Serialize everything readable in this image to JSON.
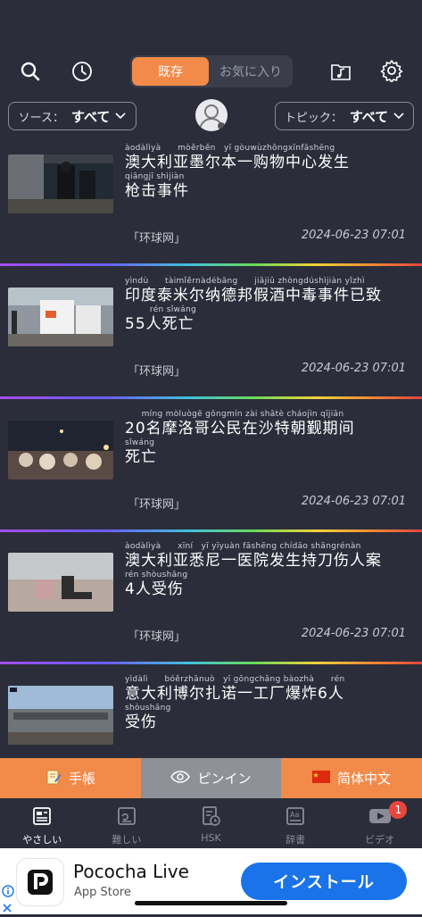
{
  "header": {
    "tab_active": "既存",
    "tab_inactive": "お気に入り"
  },
  "filters": {
    "source_label": "ソース：",
    "source_value": "すべて",
    "topic_label": "トピック：",
    "topic_value": "すべて"
  },
  "news": [
    {
      "lines": [
        {
          "pinyin": "àodàlìyà　　mòěrběn　yī gòuwùzhōngxīnfāshēng",
          "text": "澳大利亚墨尔本一购物中心发生"
        },
        {
          "pinyin": "qiāngjī shìjiàn",
          "text": "枪击事件"
        }
      ],
      "source": "「环球网」",
      "date": "2024-06-23 07:01"
    },
    {
      "lines": [
        {
          "pinyin": "yìndù　　tàimǐěrnàdébāng　　jiǎjiǔ zhòngdúshìjiàn yǐzhì",
          "text": "印度泰米尔纳德邦假酒中毒事件已致"
        },
        {
          "pinyin": "　　　rén sǐwáng",
          "text": "55人死亡"
        }
      ],
      "source": "「环球网」",
      "date": "2024-06-23 07:01"
    },
    {
      "lines": [
        {
          "pinyin": "　　míng mòluògē gōngmín zài shātè cháojìn qījiān",
          "text": "20名摩洛哥公民在沙特朝觐期间"
        },
        {
          "pinyin": "sǐwáng",
          "text": "死亡"
        }
      ],
      "source": "「环球网」",
      "date": "2024-06-23 07:01"
    },
    {
      "lines": [
        {
          "pinyin": "àodàlìyà　　xīní　yī yīyuàn fāshēng chídāo shāngrénàn",
          "text": "澳大利亚悉尼一医院发生持刀伤人案"
        },
        {
          "pinyin": "rén shòushāng",
          "text": "4人受伤"
        }
      ],
      "source": "「环球网」",
      "date": "2024-06-23 07:01"
    },
    {
      "lines": [
        {
          "pinyin": "yìdàlì　　bóěrzhānuò　yī gōngchǎng bàozhà　　rén",
          "text": "意大利博尔扎诺一工厂爆炸6人"
        },
        {
          "pinyin": "shòushāng",
          "text": "受伤"
        }
      ],
      "source": "",
      "date": ""
    }
  ],
  "actions": {
    "notebook": "手帳",
    "pinyin": "ピンイン",
    "chinese": "简体中文"
  },
  "tabs": [
    {
      "label": "やさしい"
    },
    {
      "label": "難しい"
    },
    {
      "label": "HSK"
    },
    {
      "label": "辞書"
    },
    {
      "label": "ビデオ",
      "badge": "1"
    }
  ],
  "ad": {
    "title": "Pococha Live",
    "subtitle": "App Store",
    "button": "インストール"
  }
}
